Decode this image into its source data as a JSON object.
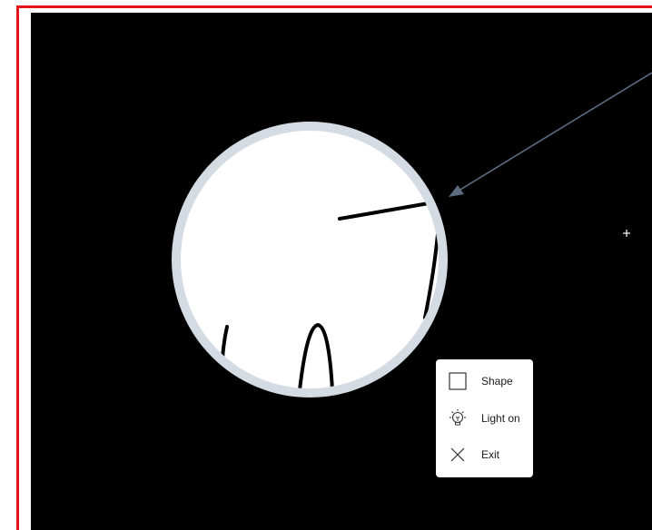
{
  "menu": {
    "items": [
      {
        "label": "Shape",
        "icon": "square-icon"
      },
      {
        "label": "Light on",
        "icon": "lightbulb-icon"
      },
      {
        "label": "Exit",
        "icon": "close-icon"
      }
    ]
  },
  "colors": {
    "frame_border": "#e8141b",
    "background": "#000000",
    "lens_ring": "#d4dbe3",
    "lens_fill": "#ffffff",
    "pointer_arrow": "#5b6b80"
  }
}
